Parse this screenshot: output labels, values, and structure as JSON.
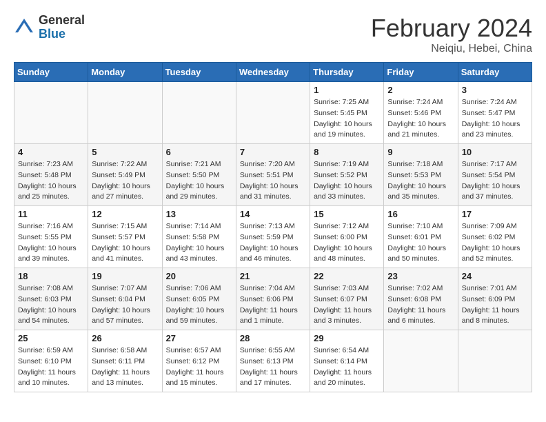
{
  "logo": {
    "general": "General",
    "blue": "Blue"
  },
  "title": {
    "month_year": "February 2024",
    "location": "Neiqiu, Hebei, China"
  },
  "days_of_week": [
    "Sunday",
    "Monday",
    "Tuesday",
    "Wednesday",
    "Thursday",
    "Friday",
    "Saturday"
  ],
  "weeks": [
    [
      {
        "day": "",
        "info": ""
      },
      {
        "day": "",
        "info": ""
      },
      {
        "day": "",
        "info": ""
      },
      {
        "day": "",
        "info": ""
      },
      {
        "day": "1",
        "info": "Sunrise: 7:25 AM\nSunset: 5:45 PM\nDaylight: 10 hours\nand 19 minutes."
      },
      {
        "day": "2",
        "info": "Sunrise: 7:24 AM\nSunset: 5:46 PM\nDaylight: 10 hours\nand 21 minutes."
      },
      {
        "day": "3",
        "info": "Sunrise: 7:24 AM\nSunset: 5:47 PM\nDaylight: 10 hours\nand 23 minutes."
      }
    ],
    [
      {
        "day": "4",
        "info": "Sunrise: 7:23 AM\nSunset: 5:48 PM\nDaylight: 10 hours\nand 25 minutes."
      },
      {
        "day": "5",
        "info": "Sunrise: 7:22 AM\nSunset: 5:49 PM\nDaylight: 10 hours\nand 27 minutes."
      },
      {
        "day": "6",
        "info": "Sunrise: 7:21 AM\nSunset: 5:50 PM\nDaylight: 10 hours\nand 29 minutes."
      },
      {
        "day": "7",
        "info": "Sunrise: 7:20 AM\nSunset: 5:51 PM\nDaylight: 10 hours\nand 31 minutes."
      },
      {
        "day": "8",
        "info": "Sunrise: 7:19 AM\nSunset: 5:52 PM\nDaylight: 10 hours\nand 33 minutes."
      },
      {
        "day": "9",
        "info": "Sunrise: 7:18 AM\nSunset: 5:53 PM\nDaylight: 10 hours\nand 35 minutes."
      },
      {
        "day": "10",
        "info": "Sunrise: 7:17 AM\nSunset: 5:54 PM\nDaylight: 10 hours\nand 37 minutes."
      }
    ],
    [
      {
        "day": "11",
        "info": "Sunrise: 7:16 AM\nSunset: 5:55 PM\nDaylight: 10 hours\nand 39 minutes."
      },
      {
        "day": "12",
        "info": "Sunrise: 7:15 AM\nSunset: 5:57 PM\nDaylight: 10 hours\nand 41 minutes."
      },
      {
        "day": "13",
        "info": "Sunrise: 7:14 AM\nSunset: 5:58 PM\nDaylight: 10 hours\nand 43 minutes."
      },
      {
        "day": "14",
        "info": "Sunrise: 7:13 AM\nSunset: 5:59 PM\nDaylight: 10 hours\nand 46 minutes."
      },
      {
        "day": "15",
        "info": "Sunrise: 7:12 AM\nSunset: 6:00 PM\nDaylight: 10 hours\nand 48 minutes."
      },
      {
        "day": "16",
        "info": "Sunrise: 7:10 AM\nSunset: 6:01 PM\nDaylight: 10 hours\nand 50 minutes."
      },
      {
        "day": "17",
        "info": "Sunrise: 7:09 AM\nSunset: 6:02 PM\nDaylight: 10 hours\nand 52 minutes."
      }
    ],
    [
      {
        "day": "18",
        "info": "Sunrise: 7:08 AM\nSunset: 6:03 PM\nDaylight: 10 hours\nand 54 minutes."
      },
      {
        "day": "19",
        "info": "Sunrise: 7:07 AM\nSunset: 6:04 PM\nDaylight: 10 hours\nand 57 minutes."
      },
      {
        "day": "20",
        "info": "Sunrise: 7:06 AM\nSunset: 6:05 PM\nDaylight: 10 hours\nand 59 minutes."
      },
      {
        "day": "21",
        "info": "Sunrise: 7:04 AM\nSunset: 6:06 PM\nDaylight: 11 hours\nand 1 minute."
      },
      {
        "day": "22",
        "info": "Sunrise: 7:03 AM\nSunset: 6:07 PM\nDaylight: 11 hours\nand 3 minutes."
      },
      {
        "day": "23",
        "info": "Sunrise: 7:02 AM\nSunset: 6:08 PM\nDaylight: 11 hours\nand 6 minutes."
      },
      {
        "day": "24",
        "info": "Sunrise: 7:01 AM\nSunset: 6:09 PM\nDaylight: 11 hours\nand 8 minutes."
      }
    ],
    [
      {
        "day": "25",
        "info": "Sunrise: 6:59 AM\nSunset: 6:10 PM\nDaylight: 11 hours\nand 10 minutes."
      },
      {
        "day": "26",
        "info": "Sunrise: 6:58 AM\nSunset: 6:11 PM\nDaylight: 11 hours\nand 13 minutes."
      },
      {
        "day": "27",
        "info": "Sunrise: 6:57 AM\nSunset: 6:12 PM\nDaylight: 11 hours\nand 15 minutes."
      },
      {
        "day": "28",
        "info": "Sunrise: 6:55 AM\nSunset: 6:13 PM\nDaylight: 11 hours\nand 17 minutes."
      },
      {
        "day": "29",
        "info": "Sunrise: 6:54 AM\nSunset: 6:14 PM\nDaylight: 11 hours\nand 20 minutes."
      },
      {
        "day": "",
        "info": ""
      },
      {
        "day": "",
        "info": ""
      }
    ]
  ]
}
